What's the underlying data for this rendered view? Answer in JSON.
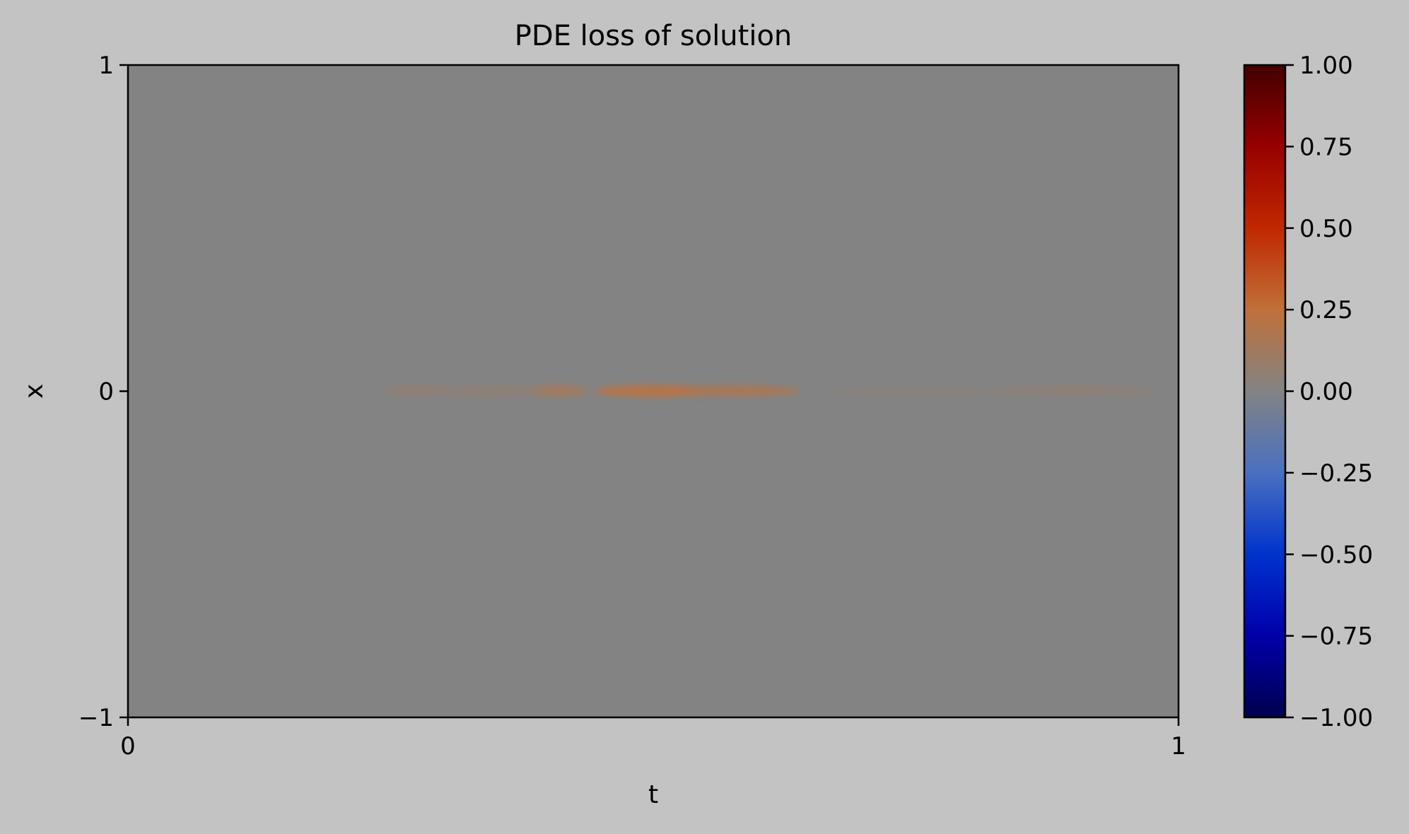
{
  "chart_data": {
    "type": "heatmap",
    "title": "PDE loss of solution",
    "xlabel": "t",
    "ylabel": "x",
    "xlim": [
      0,
      1
    ],
    "ylim": [
      -1,
      1
    ],
    "x_ticks": [
      0,
      1
    ],
    "x_tick_labels": [
      "0",
      "1"
    ],
    "y_ticks": [
      -1,
      0,
      1
    ],
    "y_tick_labels": [
      "−1",
      "0",
      "1"
    ],
    "background_value": 0.0,
    "grid": false,
    "colorbar": {
      "vmin": -1.0,
      "vmax": 1.0,
      "ticks": [
        1.0,
        0.75,
        0.5,
        0.25,
        0.0,
        -0.25,
        -0.5,
        -0.75,
        -1.0
      ],
      "tick_labels": [
        "1.00",
        "0.75",
        "0.50",
        "0.25",
        "0.00",
        "−0.25",
        "−0.50",
        "−0.75",
        "−1.00"
      ],
      "colormap_stops": [
        {
          "value": -1.0,
          "color": "#000050"
        },
        {
          "value": -0.75,
          "color": "#0000aa"
        },
        {
          "value": -0.5,
          "color": "#0033cc"
        },
        {
          "value": -0.25,
          "color": "#4a70c0"
        },
        {
          "value": 0.0,
          "color": "#838383"
        },
        {
          "value": 0.25,
          "color": "#c0703a"
        },
        {
          "value": 0.5,
          "color": "#c02800"
        },
        {
          "value": 0.75,
          "color": "#980000"
        },
        {
          "value": 1.0,
          "color": "#420000"
        }
      ]
    },
    "features": [
      {
        "t": 0.41,
        "x": 0.0,
        "value": 0.12,
        "t_width": 0.055,
        "x_width": 0.018
      },
      {
        "t": 0.5,
        "x": 0.0,
        "value": 0.2,
        "t_width": 0.11,
        "x_width": 0.02
      },
      {
        "t": 0.585,
        "x": 0.0,
        "value": 0.14,
        "t_width": 0.11,
        "x_width": 0.018
      },
      {
        "t": 0.345,
        "x": 0.0,
        "value": 0.04,
        "t_width": 0.1,
        "x_width": 0.015
      },
      {
        "t": 0.275,
        "x": 0.0,
        "value": 0.05,
        "t_width": 0.06,
        "x_width": 0.015
      },
      {
        "t": 0.9,
        "x": 0.0,
        "value": 0.04,
        "t_width": 0.16,
        "x_width": 0.012
      },
      {
        "t": 0.75,
        "x": 0.0,
        "value": 0.02,
        "t_width": 0.18,
        "x_width": 0.01
      }
    ]
  }
}
